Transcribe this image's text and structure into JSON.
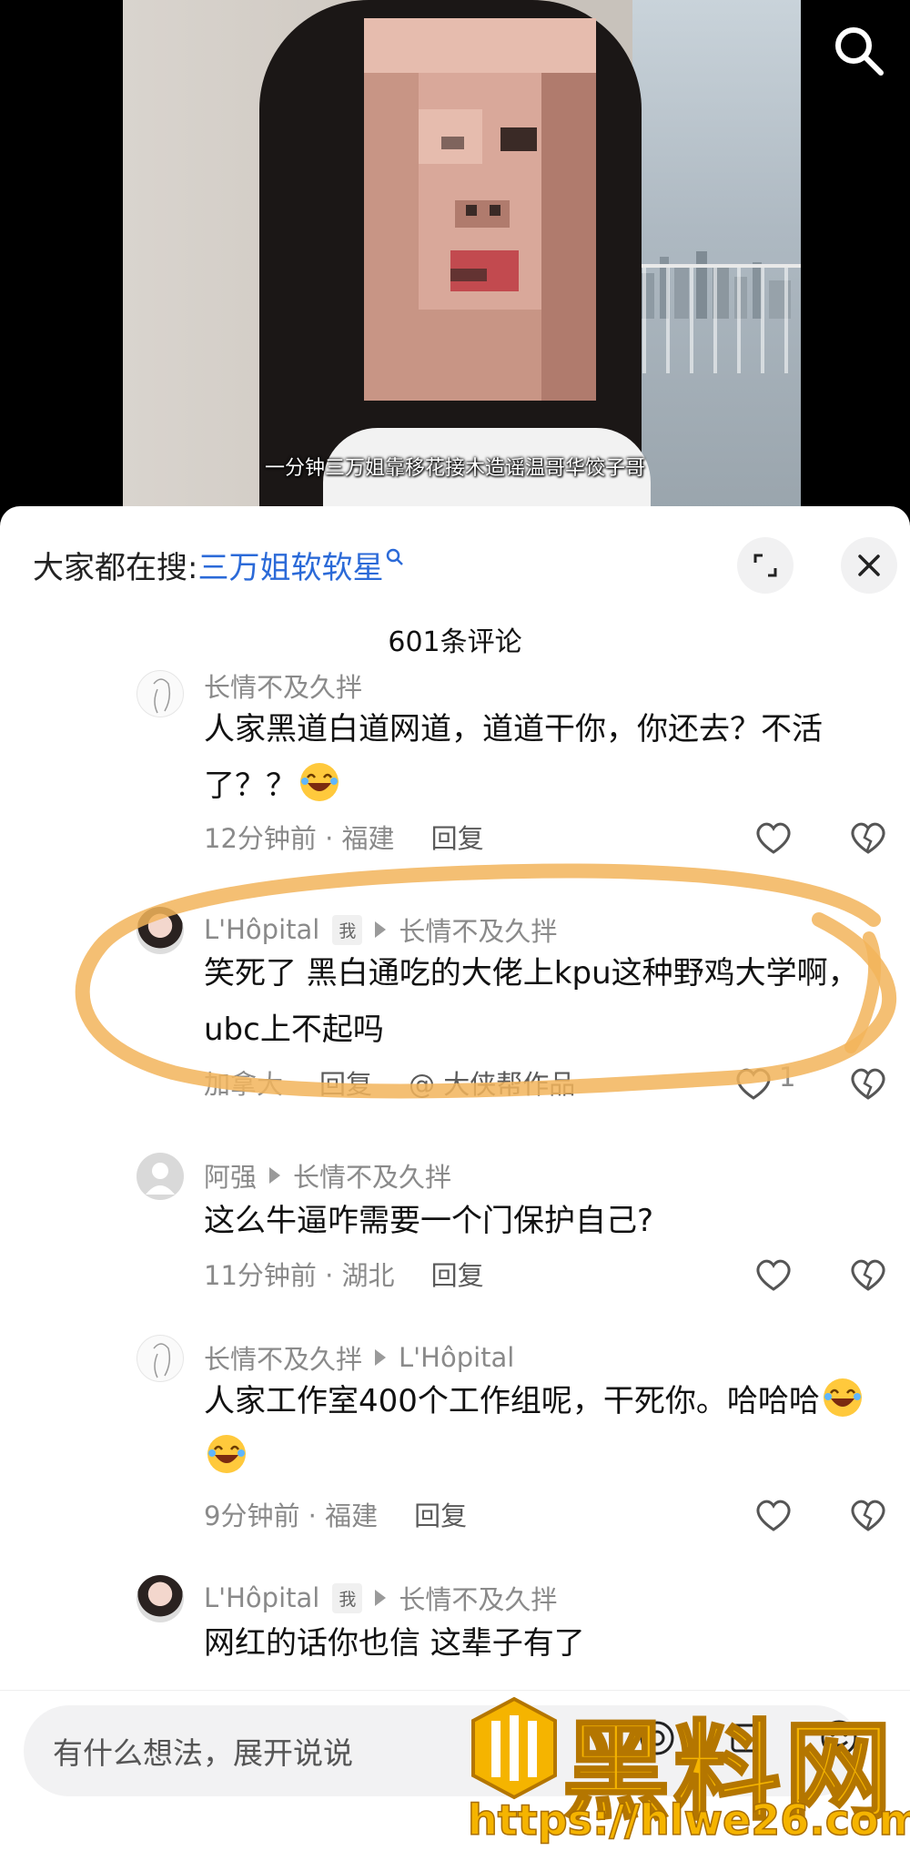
{
  "video": {
    "subtitle": "一分钟三万姐靠移花接木造谣温哥华饺子哥",
    "search_icon": "search-icon"
  },
  "sheet": {
    "hot_search_prefix": "大家都在搜:",
    "hot_search_keyword": "三万姐软软星",
    "expand_icon": "expand-icon",
    "close_icon": "close-icon",
    "comment_count": "601条评论"
  },
  "comments": [
    {
      "author": "长情不及久拌",
      "body": "人家黑道白道网道，道道干你，你还去？不活了？？",
      "emoji_count": 1,
      "time_loc": "12分钟前 · 福建",
      "reply_label": "回复"
    },
    {
      "author": "L'Hôpital",
      "me_badge": "我",
      "reply_to": "长情不及久拌",
      "body": "笑死了 黑白通吃的大佬上kpu这种野鸡大学啊，ubc上不起吗",
      "time_loc": "加拿大",
      "reply_label": "回复",
      "extra": "@ 大侠帮作品",
      "likes": "1"
    },
    {
      "author": "阿强",
      "reply_to": "长情不及久拌",
      "body": "这么牛逼咋需要一个门保护自己?",
      "time_loc": "11分钟前 · 湖北",
      "reply_label": "回复"
    },
    {
      "author": "长情不及久拌",
      "reply_to": "L'Hôpital",
      "body": "人家工作室400个工作组呢，干死你。哈哈哈",
      "emoji_count": 2,
      "time_loc": "9分钟前 · 福建",
      "reply_label": "回复"
    },
    {
      "author": "L'Hôpital",
      "me_badge": "我",
      "reply_to": "长情不及久拌",
      "body": "网红的话你也信 这辈子有了"
    }
  ],
  "input_bar": {
    "placeholder": "有什么想法，展开说说"
  },
  "watermark": {
    "title": "黑料网",
    "url": "https://hlwe26.com"
  },
  "colors": {
    "highlight": "#f2b45a",
    "keyword_blue": "#2b6ad8",
    "watermark_gold": "#f5b400"
  }
}
